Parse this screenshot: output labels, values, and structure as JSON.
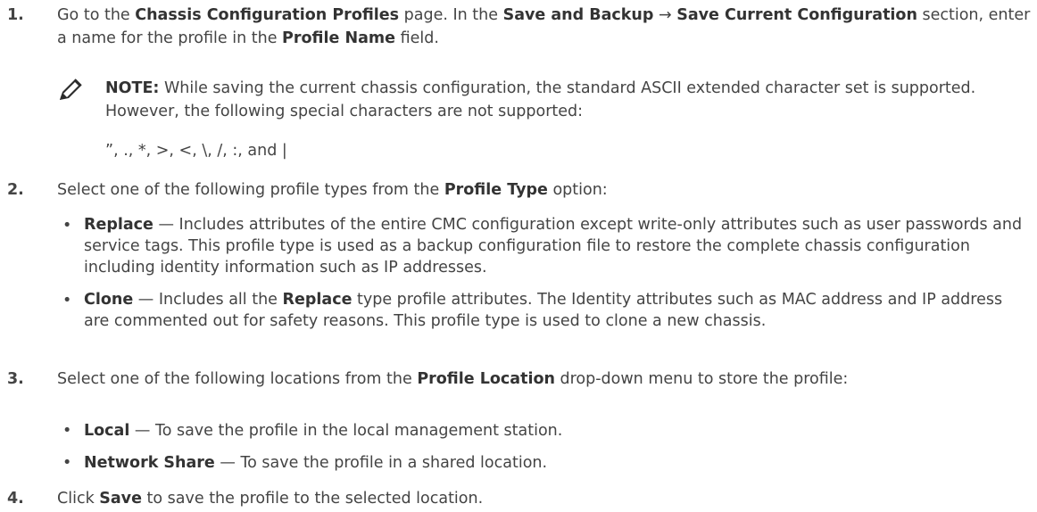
{
  "steps": [
    {
      "num": "1.",
      "t1": "Go to the ",
      "b1": "Chassis Configuration Profiles",
      "t2": " page. In the ",
      "b2": "Save and Backup",
      "arrow": " → ",
      "b3": "Save Current Configuration",
      "t3": " section, enter a name for the profile in the ",
      "b4": "Profile Name",
      "t4": " field.",
      "note": {
        "icon": "pencil-icon",
        "label": "NOTE:",
        "text": " While saving the current chassis configuration, the standard ASCII extended character set is supported. However, the following special characters are not supported:",
        "chars": "”, ., *, >, <, \\, /, :, and |"
      }
    },
    {
      "num": "2.",
      "t1": "Select one of the following profile types from the ",
      "b1": "Profile Type",
      "t2": " option:",
      "bullets": [
        {
          "term": "Replace",
          "text": " — Includes attributes of the entire CMC configuration except write-only attributes such as user passwords and service tags. This profile type is used as a backup configuration file to restore the complete chassis configuration including identity information such as IP addresses."
        },
        {
          "term": "Clone",
          "text_a": " — Includes all the ",
          "term2": "Replace",
          "text_b": " type profile attributes. The Identity attributes such as MAC address and IP address are commented out for safety reasons. This profile type is used to clone a new chassis."
        }
      ]
    },
    {
      "num": "3.",
      "t1": "Select one of the following locations from the ",
      "b1": "Profile Location",
      "t2": " drop-down menu to store the profile:",
      "bullets": [
        {
          "term": "Local",
          "text": " — To save the profile in the local management station."
        },
        {
          "term": "Network Share",
          "text": " — To save the profile in a shared location."
        }
      ]
    },
    {
      "num": "4.",
      "t1": "Click ",
      "b1": "Save",
      "t2": " to save the profile to the selected location."
    }
  ],
  "bullet_char": "•"
}
